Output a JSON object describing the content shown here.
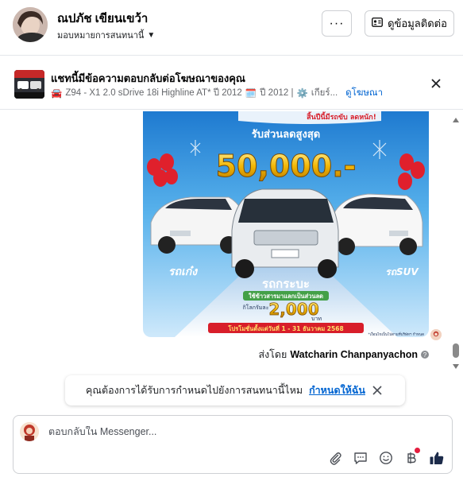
{
  "header": {
    "contact_name": "ณปภัช เขียนเขว้า",
    "assign_label": "มอบหมายการสนทนานี้",
    "more_label": "···",
    "view_contact_label": "ดูข้อมูลติดต่อ"
  },
  "ad_banner": {
    "title": "แชทนี้มีข้อความตอบกลับต่อโฆษณาของคุณ",
    "car_emoji": "🚘",
    "subtitle_a": "Z94 - X1 2.0 sDrive 18i Highline AT* ปี 2012",
    "calendar_emoji": "🗓️",
    "subtitle_b": "ปี 2012 |",
    "gear_emoji": "⚙️",
    "subtitle_c": "เกียร์...",
    "view_ad_label": "ดูโฆษณา"
  },
  "message": {
    "promo": {
      "top_banner": "สิ้นปีนี้มีรถขับ ลดหนัก!",
      "headline": "รับส่วนลดสูงสุด",
      "amount": "50,000.-",
      "left_badge": "รถเก๋ง",
      "center_badge": "รถกระบะ",
      "right_badge": "รถSUV",
      "trade_in": "ใช้ข้าวสารมาแลกเป็นส่วนลด",
      "per_kg": "กิโลกรัมละ",
      "trade_amount": "2,000",
      "unit": "บาท",
      "period": "โปรโมชั่นตั้งแต่วันที่ 1 - 31 ธันวาคม 2568",
      "fine_print": "*เงื่อนไขเป็นไปตามที่บริษัทฯ กำหนด"
    },
    "sent_by_label": "ส่งโดย",
    "sent_by_name": "Watcharin Chanpanyachon",
    "info_glyph": "?"
  },
  "toast": {
    "text": "คุณต้องการได้รับการกำหนดไปยังการสนทนานี้ไหม",
    "assign_me_label": "กำหนดให้ฉัน"
  },
  "composer": {
    "placeholder": "ตอบกลับใน Messenger..."
  },
  "colors": {
    "link_blue": "#0064d1",
    "like_blue": "#0866ff",
    "promo_sky": "#2f8fdc",
    "promo_gold": "#f2b705",
    "promo_red": "#d81e2a",
    "notification_red": "#e41e3f"
  }
}
